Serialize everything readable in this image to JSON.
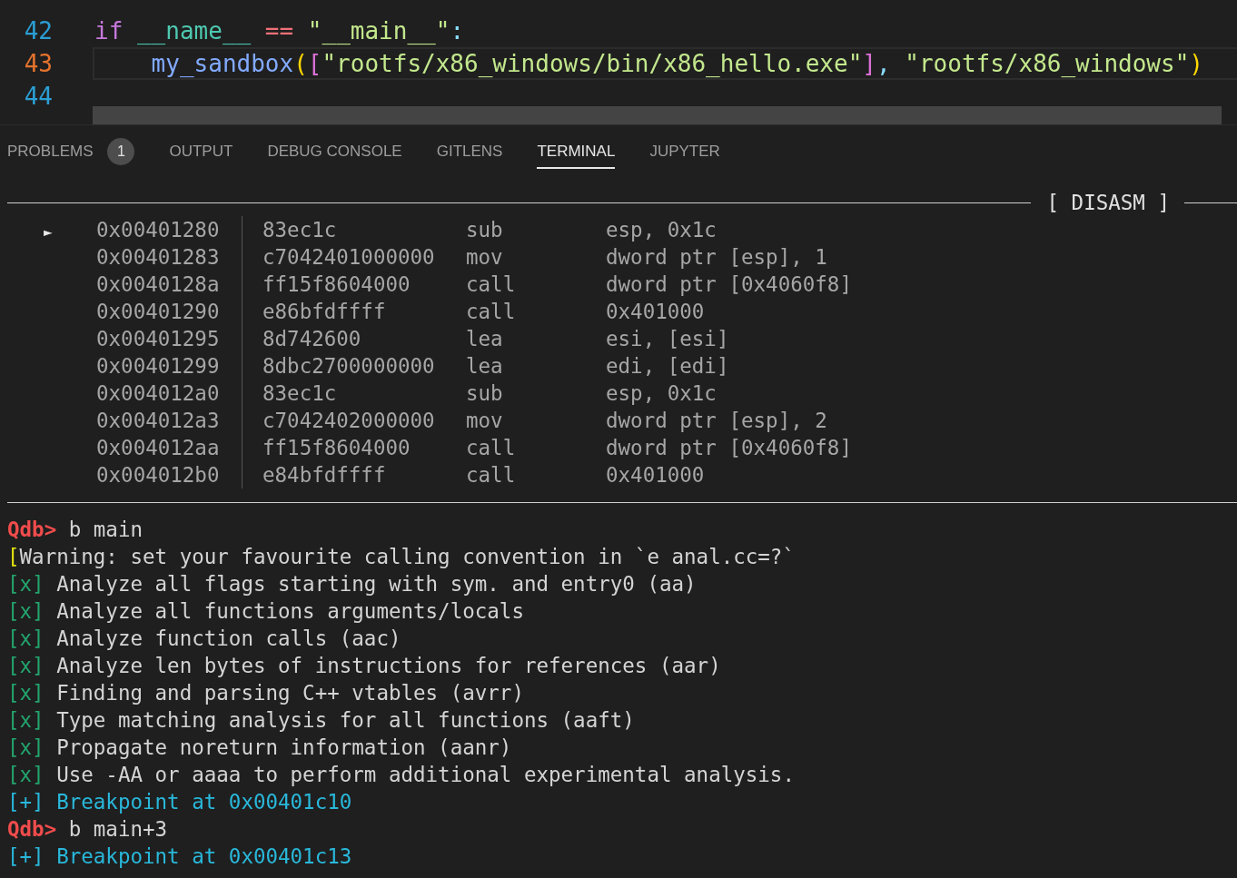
{
  "editor": {
    "lines": [
      {
        "number": "42",
        "current": false,
        "tokens": [
          {
            "text": "if ",
            "kind": "keyword"
          },
          {
            "text": "__name__ ",
            "kind": "dunder"
          },
          {
            "text": "== ",
            "kind": "operator"
          },
          {
            "text": "\"",
            "kind": "quote"
          },
          {
            "text": "__main__",
            "kind": "string"
          },
          {
            "text": "\"",
            "kind": "quote"
          },
          {
            "text": ":",
            "kind": "punct"
          }
        ]
      },
      {
        "number": "43",
        "current": true,
        "tokens": [
          {
            "text": "    my_sandbox",
            "kind": "function"
          },
          {
            "text": "(",
            "kind": "bracket1"
          },
          {
            "text": "[",
            "kind": "bracket2"
          },
          {
            "text": "\"rootfs/x86_windows/bin/x86_hello.exe\"",
            "kind": "string"
          },
          {
            "text": "]",
            "kind": "bracket2"
          },
          {
            "text": ", ",
            "kind": "punct"
          },
          {
            "text": "\"rootfs/x86_windows\"",
            "kind": "string"
          },
          {
            "text": ")",
            "kind": "bracket1"
          }
        ]
      },
      {
        "number": "44",
        "current": false
      }
    ]
  },
  "panel": {
    "tabs": [
      {
        "label": "PROBLEMS",
        "selected": false,
        "badge": "1"
      },
      {
        "label": "OUTPUT",
        "selected": false
      },
      {
        "label": "DEBUG CONSOLE",
        "selected": false
      },
      {
        "label": "GITLENS",
        "selected": false
      },
      {
        "label": "TERMINAL",
        "selected": true
      },
      {
        "label": "JUPYTER",
        "selected": false
      }
    ]
  },
  "terminal": {
    "disasm": {
      "title": "[ DISASM ]",
      "pointer": "►",
      "rows": [
        {
          "current": true,
          "address": "0x00401280",
          "bytes": "83ec1c",
          "mnemonic": "sub",
          "operands": "esp, 0x1c"
        },
        {
          "current": false,
          "address": "0x00401283",
          "bytes": "c7042401000000",
          "mnemonic": "mov",
          "operands": "dword ptr [esp], 1"
        },
        {
          "current": false,
          "address": "0x0040128a",
          "bytes": "ff15f8604000",
          "mnemonic": "call",
          "operands": "dword ptr [0x4060f8]"
        },
        {
          "current": false,
          "address": "0x00401290",
          "bytes": "e86bfdffff",
          "mnemonic": "call",
          "operands": "0x401000"
        },
        {
          "current": false,
          "address": "0x00401295",
          "bytes": "8d742600",
          "mnemonic": "lea",
          "operands": "esi, [esi]"
        },
        {
          "current": false,
          "address": "0x00401299",
          "bytes": "8dbc2700000000",
          "mnemonic": "lea",
          "operands": "edi, [edi]"
        },
        {
          "current": false,
          "address": "0x004012a0",
          "bytes": "83ec1c",
          "mnemonic": "sub",
          "operands": "esp, 0x1c"
        },
        {
          "current": false,
          "address": "0x004012a3",
          "bytes": "c7042402000000",
          "mnemonic": "mov",
          "operands": "dword ptr [esp], 2"
        },
        {
          "current": false,
          "address": "0x004012aa",
          "bytes": "ff15f8604000",
          "mnemonic": "call",
          "operands": "dword ptr [0x4060f8]"
        },
        {
          "current": false,
          "address": "0x004012b0",
          "bytes": "e84bfdffff",
          "mnemonic": "call",
          "operands": "0x401000"
        }
      ]
    },
    "lines": [
      {
        "segments": [
          {
            "text": "Qdb>",
            "kind": "prompt"
          },
          {
            "text": " b main",
            "kind": "plain"
          }
        ]
      },
      {
        "segments": [
          {
            "text": "[",
            "kind": "warn"
          },
          {
            "text": "Warning: set your favourite calling convention in `e anal.cc=?`",
            "kind": "plain"
          }
        ]
      },
      {
        "segments": [
          {
            "text": "[x]",
            "kind": "ok"
          },
          {
            "text": " Analyze all flags starting with sym. and entry0 (aa)",
            "kind": "plain"
          }
        ]
      },
      {
        "segments": [
          {
            "text": "[x]",
            "kind": "ok"
          },
          {
            "text": " Analyze all functions arguments/locals",
            "kind": "plain"
          }
        ]
      },
      {
        "segments": [
          {
            "text": "[x]",
            "kind": "ok"
          },
          {
            "text": " Analyze function calls (aac)",
            "kind": "plain"
          }
        ]
      },
      {
        "segments": [
          {
            "text": "[x]",
            "kind": "ok"
          },
          {
            "text": " Analyze len bytes of instructions for references (aar)",
            "kind": "plain"
          }
        ]
      },
      {
        "segments": [
          {
            "text": "[x]",
            "kind": "ok"
          },
          {
            "text": " Finding and parsing C++ vtables (avrr)",
            "kind": "plain"
          }
        ]
      },
      {
        "segments": [
          {
            "text": "[x]",
            "kind": "ok"
          },
          {
            "text": " Type matching analysis for all functions (aaft)",
            "kind": "plain"
          }
        ]
      },
      {
        "segments": [
          {
            "text": "[x]",
            "kind": "ok"
          },
          {
            "text": " Propagate noreturn information (aanr)",
            "kind": "plain"
          }
        ]
      },
      {
        "segments": [
          {
            "text": "[x]",
            "kind": "ok"
          },
          {
            "text": " Use -AA or aaaa to perform additional experimental analysis.",
            "kind": "plain"
          }
        ]
      },
      {
        "segments": [
          {
            "text": "[+]",
            "kind": "info"
          },
          {
            "text": " Breakpoint at 0x00401c10",
            "kind": "info"
          }
        ]
      },
      {
        "segments": [
          {
            "text": "Qdb>",
            "kind": "prompt"
          },
          {
            "text": " b main+3",
            "kind": "plain"
          }
        ]
      },
      {
        "segments": [
          {
            "text": "[+]",
            "kind": "info"
          },
          {
            "text": " Breakpoint at 0x00401c13",
            "kind": "info"
          }
        ]
      }
    ]
  }
}
